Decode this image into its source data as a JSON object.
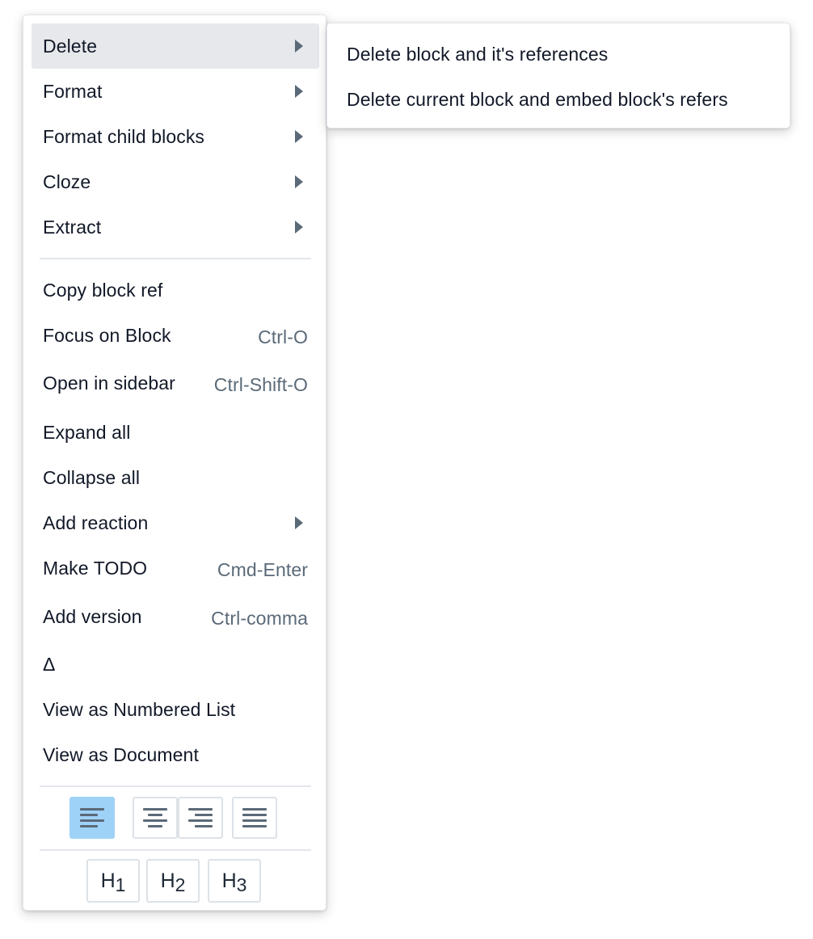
{
  "menu": {
    "items": [
      {
        "label": "Delete",
        "submenu": true
      },
      {
        "label": "Format",
        "submenu": true
      },
      {
        "label": "Format child blocks",
        "submenu": true
      },
      {
        "label": "Cloze",
        "submenu": true
      },
      {
        "label": "Extract",
        "submenu": true
      },
      {
        "label": "Copy block ref"
      },
      {
        "label": "Focus on Block",
        "shortcut": "Ctrl-O"
      },
      {
        "label": "Open in sidebar",
        "shortcut": "Ctrl-Shift-O"
      },
      {
        "label": "Expand all"
      },
      {
        "label": "Collapse all"
      },
      {
        "label": "Add reaction",
        "submenu": true
      },
      {
        "label": "Make TODO",
        "shortcut": "Cmd-Enter"
      },
      {
        "label": "Add version",
        "shortcut": "Ctrl-comma"
      },
      {
        "label": "Δ"
      },
      {
        "label": "View as Numbered List"
      },
      {
        "label": "View as Document"
      }
    ],
    "hovered_item": "Delete",
    "alignment": {
      "options": [
        "align-left-icon",
        "align-center-icon",
        "align-right-icon",
        "align-justify-icon"
      ],
      "active": "align-left-icon"
    },
    "headings": [
      {
        "letter": "H",
        "level": "1"
      },
      {
        "letter": "H",
        "level": "2"
      },
      {
        "letter": "H",
        "level": "3"
      }
    ]
  },
  "submenu": {
    "items": [
      {
        "label": "Delete block and it's references"
      },
      {
        "label": "Delete current block and embed block's refers"
      }
    ]
  },
  "colors": {
    "hover_bg": "#e6e8eb",
    "active_align_bg": "#9fd2f7",
    "shortcut_text": "#5b6a78",
    "caret": "#5b6a78",
    "border": "#dde2e7"
  }
}
